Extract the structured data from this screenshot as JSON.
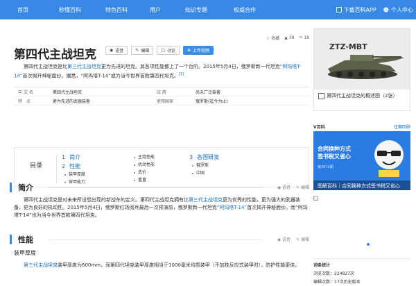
{
  "topnav": {
    "items": [
      "首页",
      "秒懂百科",
      "特色百科",
      "用户",
      "知识专题",
      "权威合作"
    ],
    "download": "下载百科APP",
    "user": "个人中心"
  },
  "article": {
    "title": "第四代主战坦克",
    "actions": {
      "voice": "语音",
      "edit": "编辑",
      "discuss": "讨论",
      "upload": "上传视频"
    },
    "stats": {
      "favorite": "收藏",
      "likes": "38",
      "shares": "18"
    },
    "intro_a": "第四代主战坦克是比",
    "intro_link1": "第三代主战坦克",
    "intro_b": "更为先进的坦克。其各项性能都上了一个台阶。2015年5月4日，俄罗斯新一代坦克",
    "intro_link2": "“阿玛塔T-14”",
    "intro_c": "首次揭开神秘面纱。据悉，“阿玛塔T-14”或为当今世界首款第四代坦克。",
    "intro_ref": "[1]"
  },
  "infobox": {
    "rows": [
      {
        "k1": "中文名",
        "v1": "第四代主战坦克",
        "k2": "应  用",
        "v2": "尚未广泛装备"
      },
      {
        "k1": "特  点",
        "v1": "更为先进的武器装备",
        "k2": "使用国家",
        "v2": "俄罗斯(迄今为止)"
      }
    ]
  },
  "toc": {
    "label": "目录",
    "col1": [
      {
        "n": "1",
        "t": "简介"
      },
      {
        "n": "2",
        "t": "性能"
      }
    ],
    "col1_sub": [
      "装甲厚度",
      "穿甲能力"
    ],
    "col2_sub": [
      "主炮性能",
      "机动性能",
      "造价",
      "重量"
    ],
    "col3": [
      {
        "n": "3",
        "t": "各国研发"
      }
    ],
    "col3_sub": [
      "俄罗斯",
      "中国"
    ]
  },
  "sections": {
    "intro_title": "简介",
    "perf_title": "性能",
    "voice": "语音",
    "edit": "编辑",
    "intro_p_a": "第四代主战坦克是对未来所设想出现的新战车的定义。第四代主战坦克拥有比",
    "intro_p_link1": "第三代主战坦克",
    "intro_p_b": "更为优秀的性能，更为强大的武器装备，更为良好的机动性。2015年5月4日，俄罗斯红场阅兵最后一次预演前，俄罗斯新一代坦克",
    "intro_p_link2": "“阿玛塔T-14”",
    "intro_p_c": "首次揭开神秘面纱。而“阿玛塔T-14”也为当今世界首款第四代坦克。",
    "armor_title": "装甲厚度",
    "armor_p_link": "第三代主战坦克",
    "armor_p": "装甲厚度为600mm，而第四代坦克装甲厚度相当于1000毫米均质装甲（不加挂反应式装甲时），防护性能更佳。"
  },
  "sidebar": {
    "album_label": "ZTZ-MBT",
    "album_caption": "第四代主战坦克的概述图（2张）",
    "vbaike_title": "V百科",
    "vbaike_more": "往期回顾",
    "banner_line1": "合同换种方式",
    "banner_line2": "签书税又省心",
    "banner_tag": "第2072期",
    "banner_bottom": "图解百科｜合同换种方式签书税又省心",
    "stats_title": "词条统计",
    "stats_views": "浏览次数：224827次",
    "stats_edits": "编辑次数：17次历史版本"
  }
}
